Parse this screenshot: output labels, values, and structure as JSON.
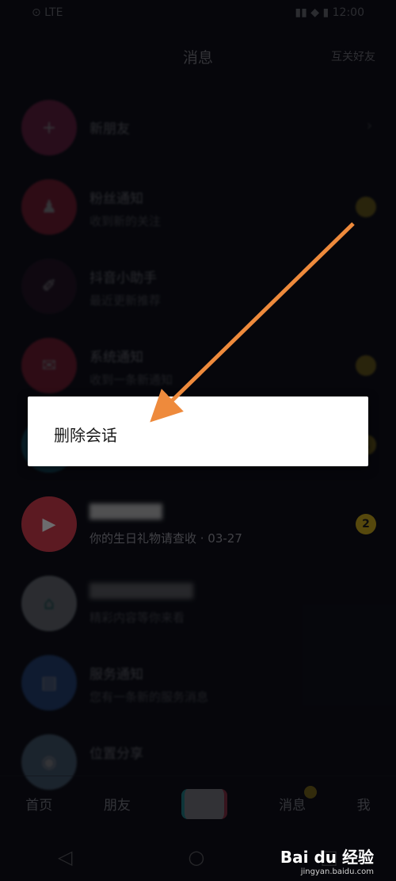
{
  "status_bar": {
    "left": "⊙ LTE",
    "right": "▮▮ ◆ ▮ 12:00"
  },
  "header": {
    "title": "消息",
    "action": "互关好友"
  },
  "conversations": [
    {
      "name": "新朋友",
      "preview": "",
      "avatar_color": "#c0306a",
      "avatar_glyph": "+",
      "badge": "",
      "chevron": "›",
      "style": "dim"
    },
    {
      "name": "粉丝通知",
      "preview": "收到新的关注",
      "avatar_color": "#e02a4a",
      "avatar_glyph": "♟",
      "badge": "",
      "chevron": "",
      "style": "dim"
    },
    {
      "name": "抖音小助手",
      "preview": "最近更新推荐",
      "avatar_color": "#3a1830",
      "avatar_glyph": "✐",
      "badge": "",
      "chevron": "",
      "style": "dim"
    },
    {
      "name": "系统通知",
      "preview": "收到一条新通知",
      "avatar_color": "#e02a4a",
      "avatar_glyph": "✉",
      "badge": "",
      "chevron": "",
      "style": "dim"
    },
    {
      "name": "",
      "preview": "",
      "avatar_color": "#1a8fb0",
      "avatar_glyph": "",
      "badge": "1",
      "chevron": "",
      "style": "dim"
    },
    {
      "name": "███████",
      "preview": "你的生日礼物请查收 · 03-27",
      "avatar_color": "#d93a4c",
      "avatar_glyph": "▶",
      "badge": "2",
      "chevron": "",
      "style": "half"
    },
    {
      "name": "██████████",
      "preview": "精彩内容等你来看",
      "avatar_color": "#cfd6dc",
      "avatar_glyph": "⌂",
      "badge": "",
      "chevron": "",
      "style": "dim"
    },
    {
      "name": "服务通知",
      "preview": "您有一条新的服务消息",
      "avatar_color": "#3b78d8",
      "avatar_glyph": "▤",
      "badge": "",
      "chevron": "",
      "style": "dim"
    },
    {
      "name": "位置分享",
      "preview": "",
      "avatar_color": "#7fa8c8",
      "avatar_glyph": "◉",
      "badge": "",
      "chevron": "",
      "style": "dim"
    }
  ],
  "tabbar": {
    "home": "首页",
    "friends": "朋友",
    "messages": "消息",
    "me": "我"
  },
  "navbar": {
    "back": "◁",
    "home": "○",
    "recent": "□"
  },
  "context_menu": {
    "delete_label": "删除会话"
  },
  "watermark": {
    "brand": "Bai du 经验",
    "url": "jingyan.baidu.com"
  },
  "colors": {
    "badge": "#c9a81a",
    "annotation_arrow": "#ee8a3c",
    "background": "#0b0c14"
  }
}
